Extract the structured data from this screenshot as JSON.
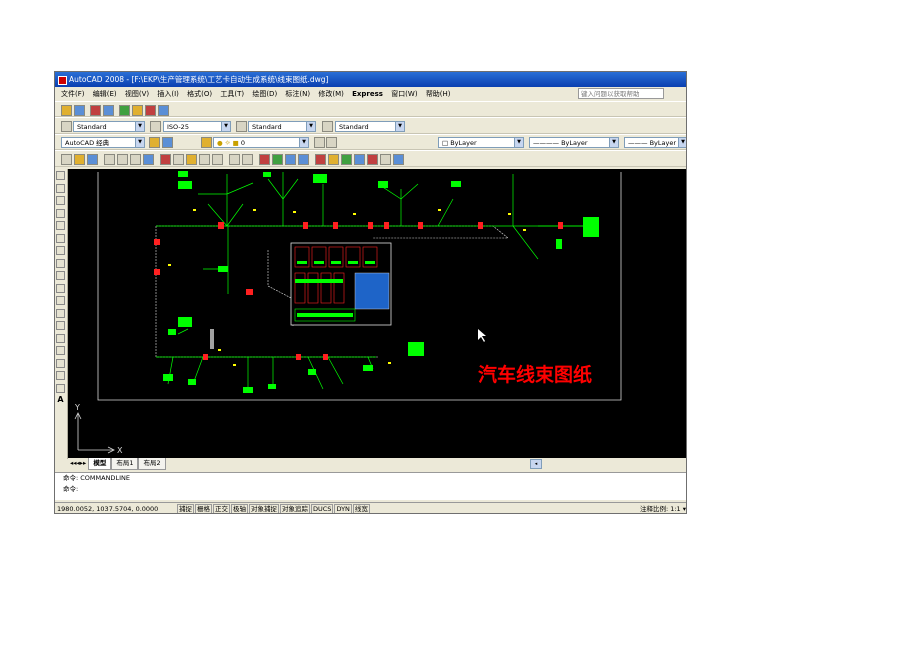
{
  "window": {
    "title": "AutoCAD 2008 - [F:\\EKP\\生产管理系统\\工艺卡自动生成系统\\线束图纸.dwg]"
  },
  "menu": [
    "文件(F)",
    "编辑(E)",
    "视图(V)",
    "插入(I)",
    "格式(O)",
    "工具(T)",
    "绘图(D)",
    "标注(N)",
    "修改(M)",
    "Express",
    "窗口(W)",
    "帮助(H)"
  ],
  "help_search": {
    "placeholder": "键入问题以获取帮助"
  },
  "styles": {
    "text_style": "Standard",
    "dim_style": "ISO-25",
    "table_style": "Standard",
    "multileader_style": "Standard"
  },
  "workspace": "AutoCAD 经典",
  "layer": "0",
  "properties": {
    "color": "ByLayer",
    "linetype": "ByLayer",
    "lineweight": "ByLayer"
  },
  "drawing": {
    "title_text": "汽车线束图纸",
    "ucs_x": "X",
    "ucs_y": "Y"
  },
  "layout_tabs": [
    "模型",
    "布局1",
    "布局2"
  ],
  "command_lines": [
    "命令: COMMANDLINE",
    "命令:"
  ],
  "status": {
    "coords": "1980.0052, 1037.5704, 0.0000",
    "toggles": [
      "捕捉",
      "栅格",
      "正交",
      "极轴",
      "对象捕捉",
      "对象追踪",
      "DUCS",
      "DYN",
      "线宽"
    ],
    "annotation_scale": "注释比例: 1:1"
  },
  "colors": {
    "canvas": "#000000",
    "wire_green": "#00ff00",
    "connector_red": "#ff2020",
    "title_red": "#ff0000",
    "border_white": "#d8d8d8",
    "blue_fill": "#1e64c8",
    "titlebar_blue": "#0a3fb0"
  }
}
